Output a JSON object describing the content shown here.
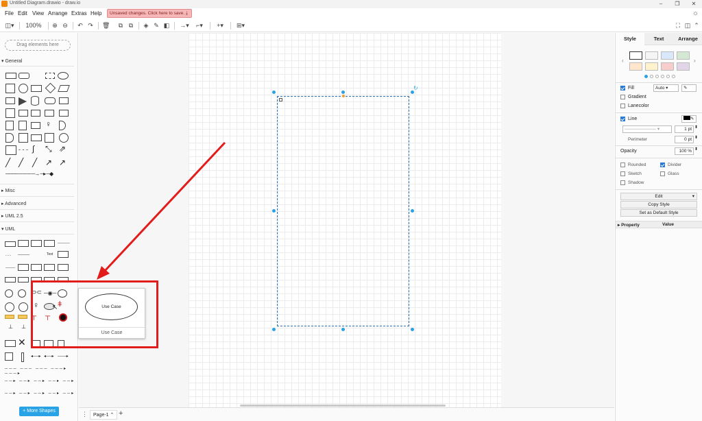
{
  "window": {
    "title": "Untitled Diagram.drawio - draw.io"
  },
  "menu": {
    "items": [
      "File",
      "Edit",
      "View",
      "Arrange",
      "Extras",
      "Help"
    ],
    "unsaved_notice": "Unsaved changes. Click here to save."
  },
  "toolbar": {
    "zoom": "100%"
  },
  "sidebar": {
    "search_placeholder": "Drag elements here",
    "sections": [
      "General",
      "Misc",
      "Advanced",
      "UML 2.5",
      "UML"
    ],
    "more_shapes": "+ More Shapes"
  },
  "preview": {
    "shape_label": "Use Case",
    "caption": "Use Case"
  },
  "bottom": {
    "page_tab": "Page-1"
  },
  "format_panel": {
    "tabs": [
      "Style",
      "Text",
      "Arrange"
    ],
    "fill_label": "Fill",
    "fill_mode": "Auto",
    "gradient_label": "Gradient",
    "lanecolor_label": "Lanecolor",
    "line_label": "Line",
    "line_width": "1 pt",
    "perimeter_label": "Perimeter",
    "perimeter_value": "0 pt",
    "opacity_label": "Opacity",
    "opacity_value": "100 %",
    "rounded_label": "Rounded",
    "divider_label": "Divider",
    "sketch_label": "Sketch",
    "glass_label": "Glass",
    "shadow_label": "Shadow",
    "edit_label": "Edit",
    "copy_style_label": "Copy Style",
    "set_default_label": "Set as Default Style",
    "property_header": "Property",
    "value_header": "Value"
  },
  "colors": {
    "accent": "#29a3e5",
    "highlight": "#e21b1b",
    "swatches": [
      "#ffffff",
      "#f5f5f5",
      "#dae8fc",
      "#d5e8d4",
      "#ffe6cc",
      "#fff2cc",
      "#f8cecc",
      "#e1d5e7"
    ]
  }
}
